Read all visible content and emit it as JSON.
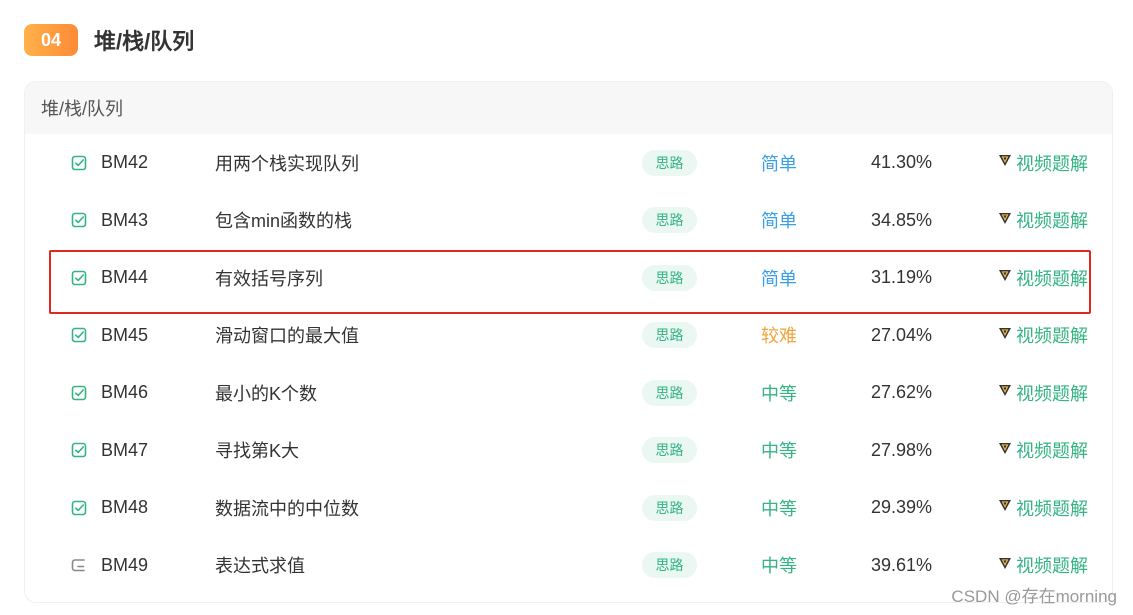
{
  "section": {
    "number": "04",
    "title": "堆/栈/队列"
  },
  "card": {
    "heading": "堆/栈/队列"
  },
  "problems": [
    {
      "id": "BM42",
      "title": "用两个栈实现队列",
      "hint": "思路",
      "difficulty": "简单",
      "level": "easy",
      "pass_rate": "41.30%",
      "video": "视频题解",
      "status_icon": "check-square-icon",
      "highlighted": false
    },
    {
      "id": "BM43",
      "title": "包含min函数的栈",
      "hint": "思路",
      "difficulty": "简单",
      "level": "easy",
      "pass_rate": "34.85%",
      "video": "视频题解",
      "status_icon": "check-square-icon",
      "highlighted": false
    },
    {
      "id": "BM44",
      "title": "有效括号序列",
      "hint": "思路",
      "difficulty": "简单",
      "level": "easy",
      "pass_rate": "31.19%",
      "video": "视频题解",
      "status_icon": "check-square-icon",
      "highlighted": true
    },
    {
      "id": "BM45",
      "title": "滑动窗口的最大值",
      "hint": "思路",
      "difficulty": "较难",
      "level": "hard",
      "pass_rate": "27.04%",
      "video": "视频题解",
      "status_icon": "check-square-icon",
      "highlighted": false
    },
    {
      "id": "BM46",
      "title": "最小的K个数",
      "hint": "思路",
      "difficulty": "中等",
      "level": "medium",
      "pass_rate": "27.62%",
      "video": "视频题解",
      "status_icon": "check-square-icon",
      "highlighted": false
    },
    {
      "id": "BM47",
      "title": "寻找第K大",
      "hint": "思路",
      "difficulty": "中等",
      "level": "medium",
      "pass_rate": "27.98%",
      "video": "视频题解",
      "status_icon": "check-square-icon",
      "highlighted": false
    },
    {
      "id": "BM48",
      "title": "数据流中的中位数",
      "hint": "思路",
      "difficulty": "中等",
      "level": "medium",
      "pass_rate": "29.39%",
      "video": "视频题解",
      "status_icon": "check-square-icon",
      "highlighted": false
    },
    {
      "id": "BM49",
      "title": "表达式求值",
      "hint": "思路",
      "difficulty": "中等",
      "level": "medium",
      "pass_rate": "39.61%",
      "video": "视频题解",
      "status_icon": "unchecked-square-icon",
      "highlighted": false
    }
  ],
  "colors": {
    "accent_green": "#33b482",
    "easy_blue": "#3a9ee8",
    "hard_orange": "#f2a33a",
    "highlight_red": "#e0281e",
    "badge_orange": "#ff8a35"
  },
  "watermark": "CSDN @存在morning"
}
